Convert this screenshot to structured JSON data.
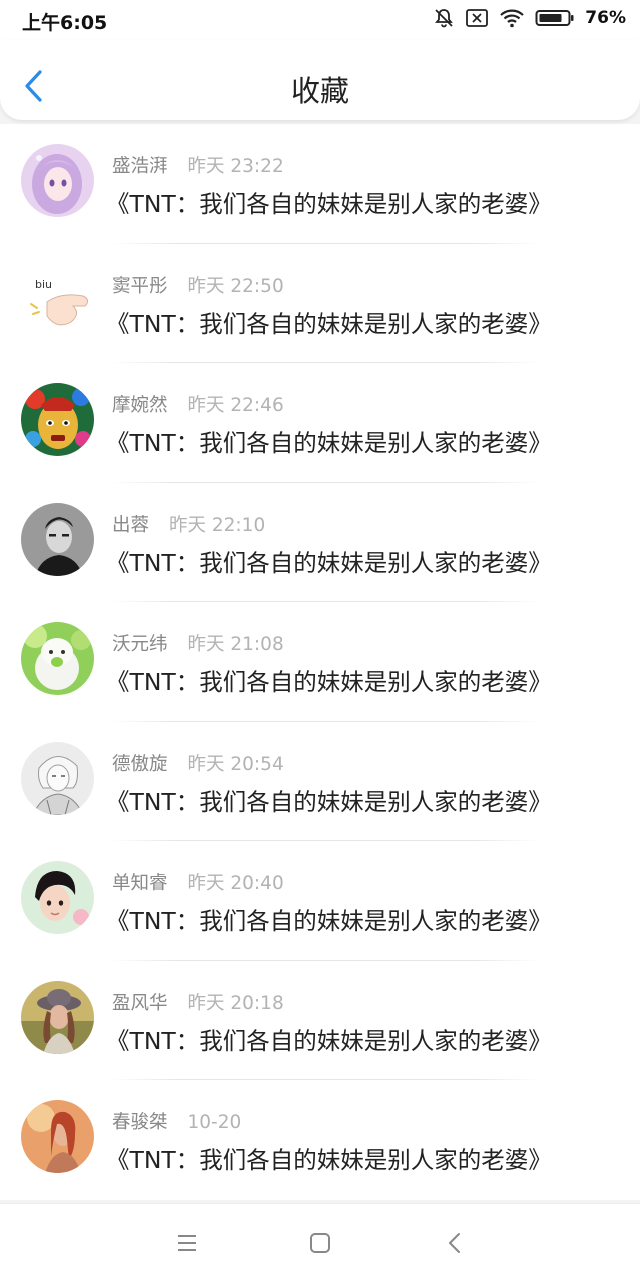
{
  "status_bar": {
    "time": "上午6:05",
    "battery": "76%",
    "icons": [
      "bell-off-icon",
      "notification-x-icon",
      "wifi-icon",
      "battery-icon"
    ]
  },
  "header": {
    "title": "收藏",
    "back_icon": "chevron-left-icon",
    "accent_color": "#2a8be8"
  },
  "items": [
    {
      "user": "盛浩湃",
      "time": "昨天 23:22",
      "title": "《TNT：我们各自的妹妹是别人家的老婆》",
      "avatar": "anime-girl-avatar"
    },
    {
      "user": "窦平彤",
      "time": "昨天 22:50",
      "title": "《TNT：我们各自的妹妹是别人家的老婆》",
      "avatar": "biu-hand-avatar"
    },
    {
      "user": "摩婉然",
      "time": "昨天 22:46",
      "title": "《TNT：我们各自的妹妹是别人家的老婆》",
      "avatar": "opera-mask-avatar"
    },
    {
      "user": "出蓉",
      "time": "昨天 22:10",
      "title": "《TNT：我们各自的妹妹是别人家的老婆》",
      "avatar": "bw-portrait-avatar"
    },
    {
      "user": "沃元纬",
      "time": "昨天 21:08",
      "title": "《TNT：我们各自的妹妹是别人家的老婆》",
      "avatar": "plush-toy-avatar"
    },
    {
      "user": "德傲旋",
      "time": "昨天 20:54",
      "title": "《TNT：我们各自的妹妹是别人家的老婆》",
      "avatar": "sketch-avatar"
    },
    {
      "user": "单知睿",
      "time": "昨天 20:40",
      "title": "《TNT：我们各自的妹妹是别人家的老婆》",
      "avatar": "boy-photo-avatar"
    },
    {
      "user": "盈风华",
      "time": "昨天 20:18",
      "title": "《TNT：我们各自的妹妹是别人家的老婆》",
      "avatar": "hat-girl-avatar"
    },
    {
      "user": "春骏桀",
      "time": "10-20",
      "title": "《TNT：我们各自的妹妹是别人家的老婆》",
      "avatar": "sunset-girl-avatar"
    }
  ],
  "nav_bar": {
    "icons": [
      "menu-icon",
      "home-square-icon",
      "back-arrow-icon"
    ]
  }
}
